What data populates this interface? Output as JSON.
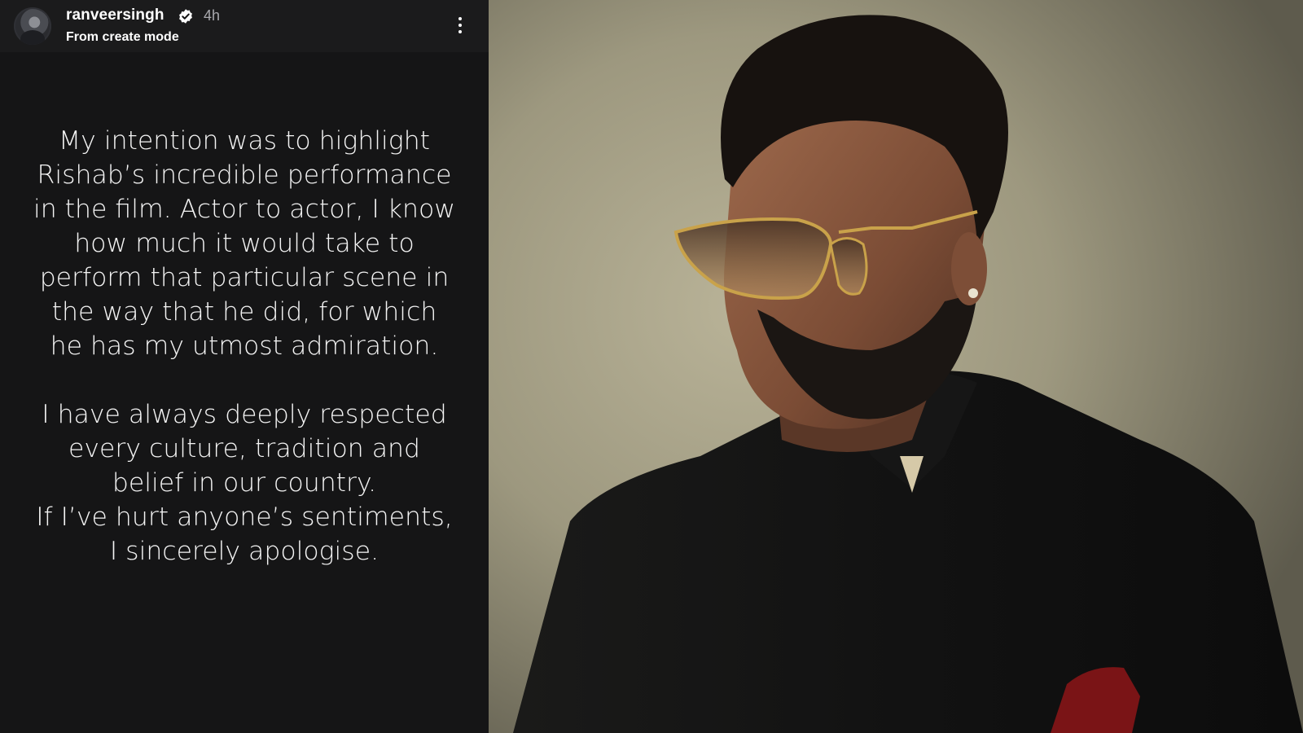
{
  "story": {
    "username": "ranveersingh",
    "verified": true,
    "time_ago": "4h",
    "subtitle": "From create mode",
    "icons": {
      "avatar": "profile-avatar",
      "verified": "verified-badge-icon",
      "more": "more-vertical-icon"
    },
    "paragraphs": [
      "My intention was to highlight Rishab’s incredible performance in the film. Actor to actor, I know how much it would take to perform that particular scene in the way that he did, for which he has my utmost admiration.",
      "I have always deeply respected every culture, tradition and belief in our country.",
      "If I’ve hurt anyone’s sentiments, I sincerely apologise."
    ]
  },
  "photo": {
    "subject": "man-in-sunglasses-black-bandhgala",
    "colors": {
      "background": "#a29d83",
      "jacket": "#151515",
      "pocket_square": "#7a1416",
      "sunglass_frame": "#c9a24a"
    }
  },
  "colors": {
    "panel_bg": "#151516",
    "header_bg": "#1b1b1c",
    "text": "#f4f4f4",
    "muted": "#a8a8ad"
  }
}
